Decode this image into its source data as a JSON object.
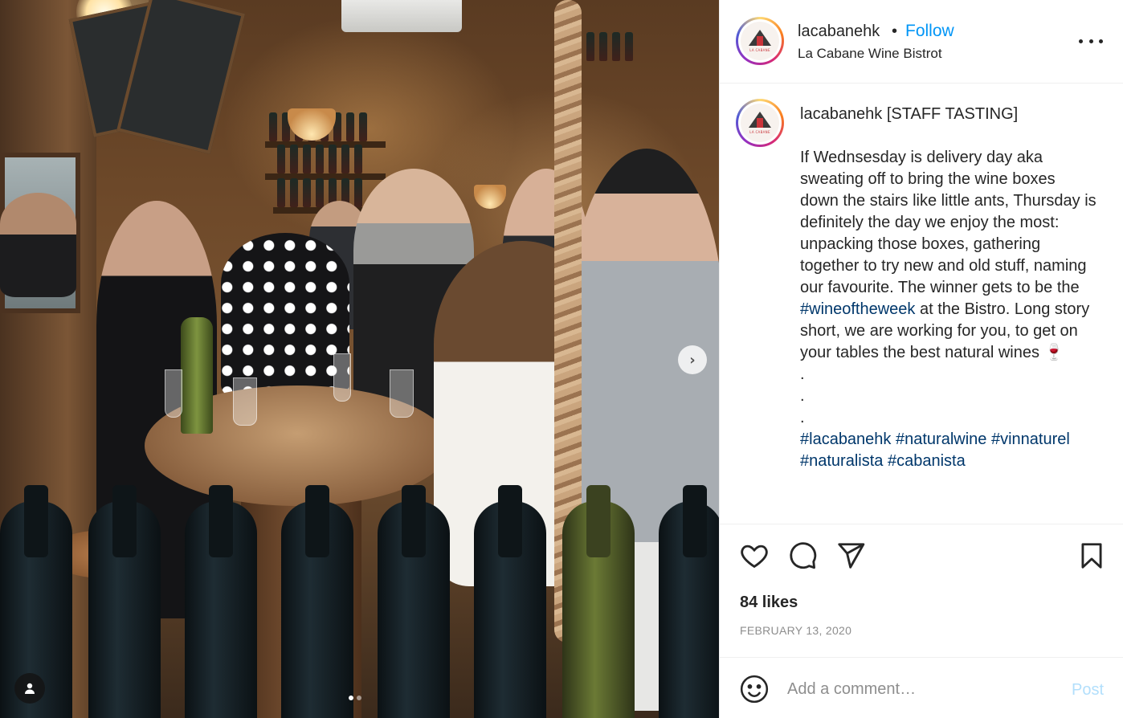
{
  "post": {
    "carousel": {
      "slide_count": 2,
      "active_slide": 1
    }
  },
  "header": {
    "username": "lacabanehk",
    "separator": "•",
    "follow_label": "Follow",
    "location": "La Cabane Wine Bistrot"
  },
  "avatar": {
    "brand_text": "LA CABANE"
  },
  "caption": {
    "username": "lacabanehk",
    "title": "[STAFF TASTING]",
    "body_part1": "If Wednsesday is delivery day aka sweating off to bring the wine boxes down the stairs like little ants, Thursday is definitely the day we enjoy the most: unpacking those boxes, gathering together to try new and old stuff, naming our favourite. The winner gets to be the ",
    "hashtag_inline": "#wineoftheweek",
    "body_part2": " at the Bistro. Long story short, we are working for you, to get on your tables the best natural wines ",
    "emoji": "🍷",
    "dots": ".\n.\n.",
    "hashtags": [
      "#lacabanehk",
      "#naturalwine",
      "#vinnaturel",
      "#naturalista",
      "#cabanista"
    ]
  },
  "engagement": {
    "likes": "84 likes",
    "date": "FEBRUARY 13, 2020"
  },
  "comment": {
    "placeholder": "Add a comment…",
    "post_label": "Post"
  },
  "colors": {
    "follow": "#0095f6",
    "hashtag": "#00376b",
    "post_disabled": "#b2dffc",
    "muted": "#8e8e8e"
  },
  "icons": {
    "like": "heart-icon",
    "comment": "comment-icon",
    "share": "paper-plane-icon",
    "save": "bookmark-icon",
    "more": "more-dots-icon",
    "next": "chevron-right-icon",
    "tag": "user-tag-icon",
    "emoji": "smiley-icon"
  }
}
